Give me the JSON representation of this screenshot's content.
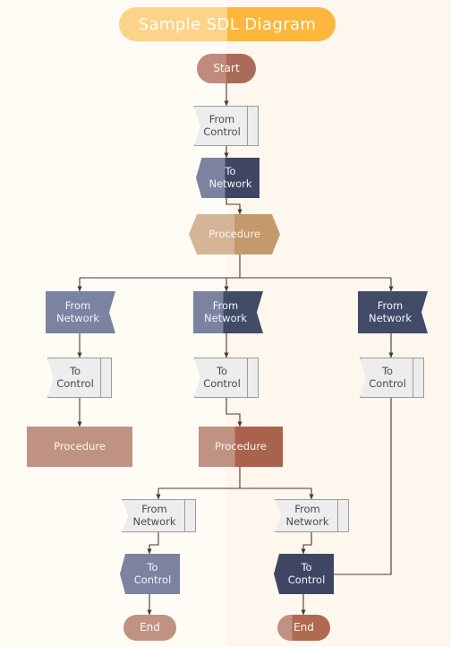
{
  "title": {
    "text": "Sample SDL Diagram"
  },
  "colors": {
    "background_left": "#fffcf6",
    "background_right": "#fdf7ee",
    "banner_left": "#fcd389",
    "banner_right": "#fdb73c",
    "terminator_light": "#c09283",
    "terminator_dark": "#a96a57",
    "procedure_rect_light": "#c09283",
    "procedure_rect_dark": "#a9624c",
    "procedure_hex_light": "#d4b595",
    "procedure_hex_dark": "#c4996b",
    "slate_light": "#7b83a0",
    "slate_dark": "#414b68",
    "gray_fill": "#ededed",
    "gray_stroke": "#9b9b9b",
    "connector": "#4a3a30"
  },
  "nodes": [
    {
      "id": "start",
      "label": "Start",
      "type": "terminator"
    },
    {
      "id": "from_control",
      "label": "From\nControl",
      "type": "flag-gray"
    },
    {
      "id": "to_network",
      "label": "To\nNetwork",
      "type": "pent-blue"
    },
    {
      "id": "procedure_1",
      "label": "Procedure",
      "type": "procedure-hex"
    },
    {
      "id": "from_net_l",
      "label": "From\nNetwork",
      "type": "flag-blue"
    },
    {
      "id": "from_net_m",
      "label": "From\nNetwork",
      "type": "flag-blue"
    },
    {
      "id": "from_net_r",
      "label": "From\nNetwork",
      "type": "flag-blue"
    },
    {
      "id": "to_ctrl_l",
      "label": "To\nControl",
      "type": "flag-gray"
    },
    {
      "id": "to_ctrl_m",
      "label": "To\nControl",
      "type": "flag-gray"
    },
    {
      "id": "to_ctrl_r",
      "label": "To\nControl",
      "type": "flag-gray"
    },
    {
      "id": "procedure_2",
      "label": "Procedure",
      "type": "procedure-rect"
    },
    {
      "id": "procedure_3",
      "label": "Procedure",
      "type": "procedure-rect"
    },
    {
      "id": "from_net_b_l",
      "label": "From\nNetwork",
      "type": "flag-gray"
    },
    {
      "id": "from_net_b_r",
      "label": "From\nNetwork",
      "type": "flag-gray"
    },
    {
      "id": "to_ctrl_b_l",
      "label": "To\nControl",
      "type": "pent-blue"
    },
    {
      "id": "to_ctrl_b_r",
      "label": "To\nControl",
      "type": "pent-blue"
    },
    {
      "id": "end_l",
      "label": "End",
      "type": "terminator"
    },
    {
      "id": "end_r",
      "label": "End",
      "type": "terminator"
    }
  ],
  "labels": {
    "start": "Start",
    "end": "End",
    "procedure": "Procedure",
    "from_control_1": "From",
    "from_control_2": "Control",
    "to_network_1": "To",
    "to_network_2": "Network",
    "from_network_1": "From",
    "from_network_2": "Network",
    "to_control_1": "To",
    "to_control_2": "Control"
  }
}
